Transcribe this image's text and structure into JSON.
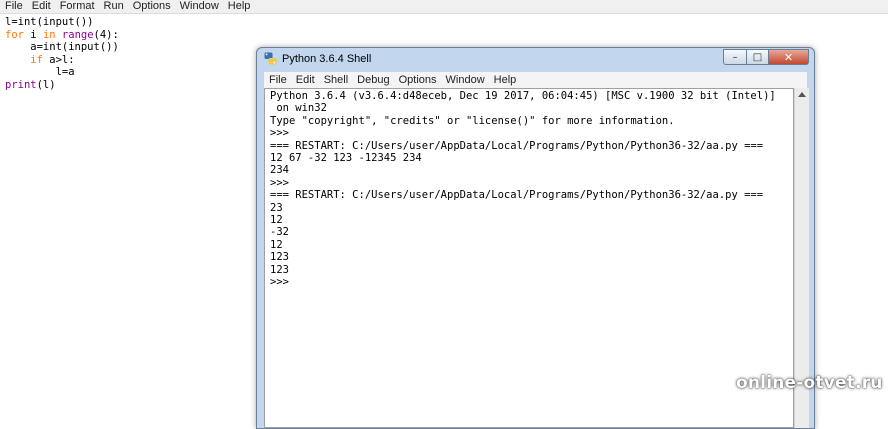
{
  "editor": {
    "menu": [
      "File",
      "Edit",
      "Format",
      "Run",
      "Options",
      "Window",
      "Help"
    ],
    "code": {
      "line1": "l=int(input())",
      "line2_kw1": "for",
      "line2_mid": " i ",
      "line2_kw2": "in",
      "line2_sp": " ",
      "line2_bi": "range",
      "line2_end": "(4):",
      "line3": "    a=int(input())",
      "line4_indent": "    ",
      "line4_kw": "if",
      "line4_rest": " a>l:",
      "line5": "        l=a",
      "line6_bi": "print",
      "line6_rest": "(l)"
    }
  },
  "shell": {
    "title": "Python 3.6.4 Shell",
    "menu": [
      "File",
      "Edit",
      "Shell",
      "Debug",
      "Options",
      "Window",
      "Help"
    ],
    "buttons": {
      "minimize": "–",
      "maximize": "□",
      "close": "✕"
    },
    "output": [
      "Python 3.6.4 (v3.6.4:d48eceb, Dec 19 2017, 06:04:45) [MSC v.1900 32 bit (Intel)]",
      " on win32",
      "Type \"copyright\", \"credits\" or \"license()\" for more information.",
      ">>> ",
      "=== RESTART: C:/Users/user/AppData/Local/Programs/Python/Python36-32/aa.py ===",
      "12 67 -32 123 -12345 234",
      "234",
      ">>> ",
      "=== RESTART: C:/Users/user/AppData/Local/Programs/Python/Python36-32/aa.py ===",
      "23",
      "12",
      "-32",
      "12",
      "123",
      "123",
      ">>> "
    ]
  },
  "watermark": "online-otvet.ru"
}
